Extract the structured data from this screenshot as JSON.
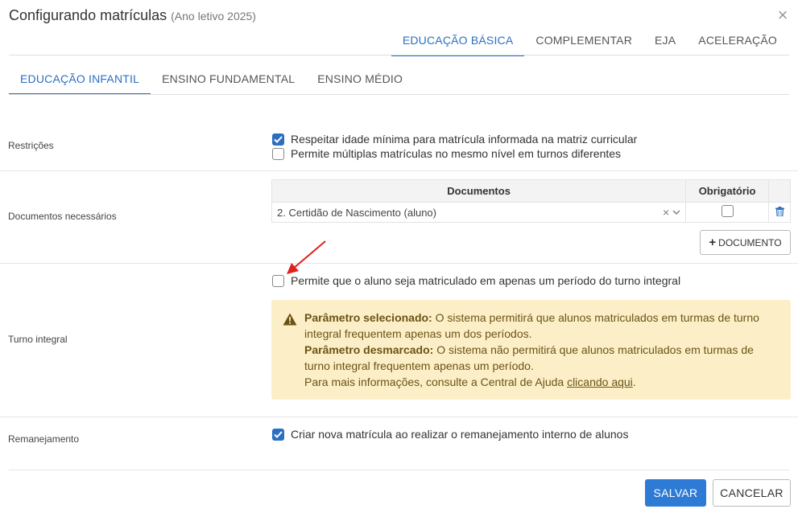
{
  "modal": {
    "title": "Configurando matrículas",
    "subtitle": "(Ano letivo 2025)",
    "close_symbol": "×"
  },
  "top_tabs": [
    {
      "label": "EDUCAÇÃO BÁSICA",
      "active": true
    },
    {
      "label": "COMPLEMENTAR",
      "active": false
    },
    {
      "label": "EJA",
      "active": false
    },
    {
      "label": "ACELERAÇÃO",
      "active": false
    }
  ],
  "sub_tabs": [
    {
      "label": "EDUCAÇÃO INFANTIL",
      "active": true
    },
    {
      "label": "ENSINO FUNDAMENTAL",
      "active": false
    },
    {
      "label": "ENSINO MÉDIO",
      "active": false
    }
  ],
  "restricoes": {
    "label": "Restrições",
    "options": [
      {
        "label": "Respeitar idade mínima para matrícula informada na matriz curricular",
        "checked": true
      },
      {
        "label": "Permite múltiplas matrículas no mesmo nível em turnos diferentes",
        "checked": false
      }
    ]
  },
  "documentos": {
    "label": "Documentos necessários",
    "columns": [
      "Documentos",
      "Obrigatório"
    ],
    "rows": [
      {
        "document": "2. Certidão de Nascimento (aluno)",
        "clear_symbol": "×",
        "required": false
      }
    ],
    "add_button": "DOCUMENTO"
  },
  "turno_integral": {
    "label": "Turno integral",
    "option": {
      "label": "Permite que o aluno seja matriculado em apenas um período do turno integral",
      "checked": false
    },
    "alert": {
      "selected_title": "Parâmetro selecionado:",
      "selected_text": "O sistema permitirá que alunos matriculados em turmas de turno integral frequentem apenas um dos períodos.",
      "unselected_title": "Parâmetro desmarcado:",
      "unselected_text": "O sistema não permitirá que alunos matriculados em turmas de turno integral frequentem apenas um período.",
      "help_text": "Para mais informações, consulte a Central de Ajuda",
      "help_link": "clicando aqui",
      "help_end": "."
    }
  },
  "remanejamento": {
    "label": "Remanejamento",
    "option": {
      "label": "Criar nova matrícula ao realizar o remanejamento interno de alunos",
      "checked": true
    }
  },
  "footer": {
    "save": "SALVAR",
    "cancel": "CANCELAR"
  },
  "colors": {
    "accent": "#2b6fc2",
    "save_button": "#2e7bd6",
    "alert_bg": "#fcefc7",
    "alert_text": "#6b5315",
    "annotation_arrow": "#e0201b"
  },
  "icons": {
    "close": "close-icon",
    "warning": "warning-icon",
    "trash": "trash-icon",
    "plus": "plus-icon",
    "chevron": "chevron-down-icon",
    "check": "check-icon"
  }
}
